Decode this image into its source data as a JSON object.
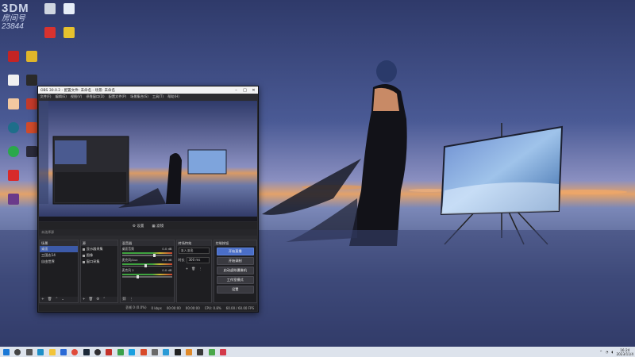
{
  "watermark": {
    "logo": "3DM",
    "line1": "房间号",
    "line2": "23844"
  },
  "obs": {
    "title": "OBS 30.0.2 - 配置文件: 未命名 - 场景: 未命名",
    "menu": [
      "文件(F)",
      "编辑(E)",
      "视图(V)",
      "停靠窗口(D)",
      "配置文件(P)",
      "场景集合(S)",
      "工具(T)",
      "帮助(H)"
    ],
    "toolbar": {
      "settings": "⚙ 设置",
      "filters": "▦ 滤镜"
    },
    "controls_row": {
      "source_label": "未选择源"
    },
    "docks": {
      "scenes_title": "场景",
      "sources_title": "源",
      "mixer_title": "混音器",
      "transitions_title": "转场特效",
      "controls_title": "控制按钮"
    },
    "scenes": [
      "桌面",
      "三国志14",
      "自由世界"
    ],
    "sources": [
      "显示器采集",
      "图像",
      "窗口采集"
    ],
    "mixer": [
      {
        "name": "桌面音频",
        "db": "0.0 dB",
        "level": 0.62
      },
      {
        "name": "麦克风/Aux",
        "db": "0.0 dB",
        "level": 0.45
      },
      {
        "name": "麦克风 2",
        "db": "0.0 dB",
        "level": 0.3
      }
    ],
    "transitions": {
      "type": "淡入淡出",
      "duration_label": "时长",
      "duration": "300 ms"
    },
    "controls": [
      "开始直播",
      "开始录制",
      "启动虚拟摄像机",
      "工作室模式",
      "设置"
    ],
    "status": {
      "dropped": "丢帧 0 (0.0%)",
      "kbps": "0 kbps",
      "stream_time": "00:00:00",
      "rec_time": "00:00:00",
      "cpu": "CPU: 0.8%",
      "fps": "60.00 / 60.00 FPS"
    }
  },
  "taskbar": {
    "icons": [
      "start-icon",
      "search-icon",
      "taskview-icon",
      "edge-icon",
      "explorer-icon",
      "store-icon",
      "chrome-icon",
      "steam-icon",
      "obs-icon",
      "game-icon",
      "music-icon",
      "chat-icon"
    ],
    "tray_time": "16:24",
    "tray_date": "2023/11/4"
  },
  "colors": {
    "accent": "#4a6ec8",
    "wallpaper_top": "#2e3c6e",
    "horizon": "#e39a5a",
    "taskbar": "#dde3ec"
  }
}
